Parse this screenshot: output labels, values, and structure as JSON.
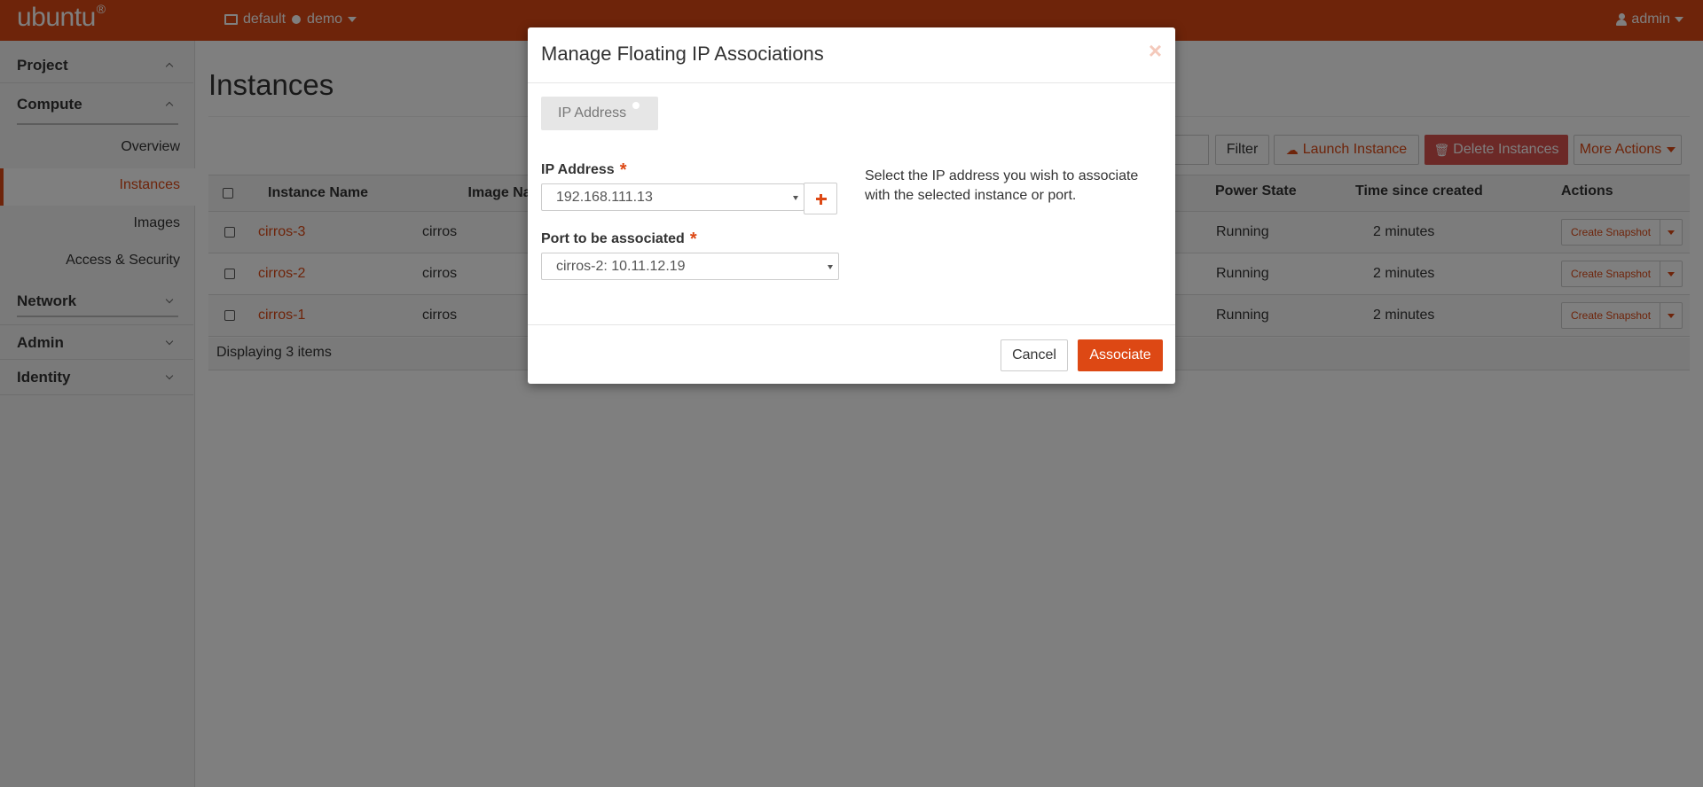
{
  "topbar": {
    "logo": "ubuntu",
    "logo_mark": "®",
    "domain": "default",
    "project": "demo",
    "user": "admin"
  },
  "sidebar": {
    "project": "Project",
    "compute": "Compute",
    "items": [
      "Overview",
      "Instances",
      "Images",
      "Access & Security"
    ],
    "network": "Network",
    "admin": "Admin",
    "identity": "Identity"
  },
  "main": {
    "title": "Instances",
    "filter_label": "Filter",
    "launch_label": "Launch Instance",
    "delete_label": "Delete Instances",
    "more_label": "More Actions",
    "columns": [
      "Instance Name",
      "Image Name",
      "Power State",
      "Time since created",
      "Actions"
    ],
    "rows": [
      {
        "name": "cirros-3",
        "image": "cirros",
        "power": "Running",
        "age": "2 minutes",
        "action": "Create Snapshot"
      },
      {
        "name": "cirros-2",
        "image": "cirros",
        "power": "Running",
        "age": "2 minutes",
        "action": "Create Snapshot"
      },
      {
        "name": "cirros-1",
        "image": "cirros",
        "power": "Running",
        "age": "2 minutes",
        "action": "Create Snapshot"
      }
    ],
    "footer": "Displaying 3 items"
  },
  "modal": {
    "title": "Manage Floating IP Associations",
    "close": "×",
    "tab": "IP Address",
    "ip_label": "IP Address",
    "ip_value": "192.168.111.13",
    "port_label": "Port to be associated",
    "port_value": "cirros-2: 10.11.12.19",
    "required_mark": "*",
    "help": "Select the IP address you wish to associate with the selected instance or port.",
    "cancel": "Cancel",
    "associate": "Associate"
  },
  "colors": {
    "brand": "#dd4814",
    "danger": "#d9534f"
  }
}
